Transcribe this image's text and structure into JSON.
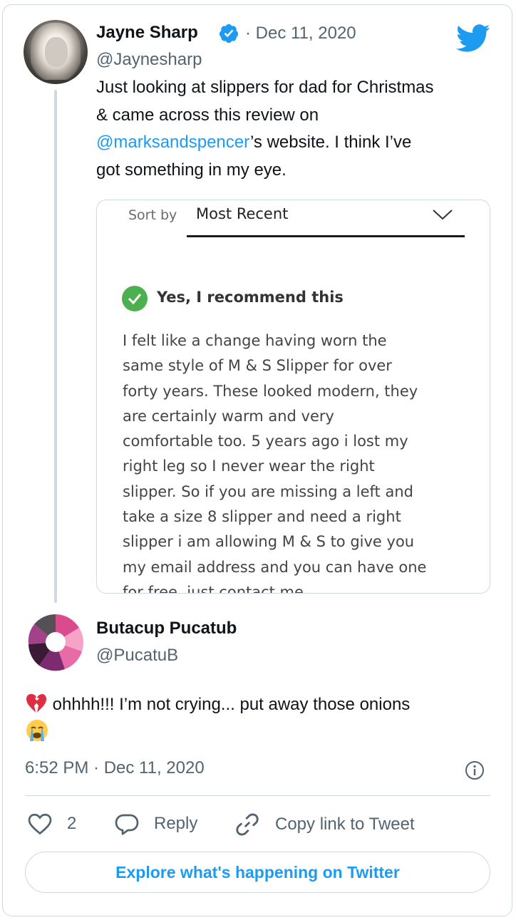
{
  "tweet": {
    "author_name": "Jayne Sharp",
    "author_handle": "@Jaynesharp",
    "date": "· Dec 11, 2020",
    "text_line1": "Just looking at slippers for dad for Christmas",
    "text_line2": "& came across this review on",
    "text_mention": "@marksandspencer",
    "text_line3_rest": "’s website. I think I’ve",
    "text_line4": "got something in my eye.",
    "verified_icon": "verified-badge-icon",
    "logo_icon": "twitter-bird-icon"
  },
  "media": {
    "sort_label": "Sort by",
    "sort_value": "Most Recent",
    "recommend": "Yes, I recommend this",
    "review_lines": [
      "I felt like a change having worn the",
      "same style of M & S Slipper for over",
      "forty years. These looked modern, they",
      "are certainly warm and very",
      "comfortable too. 5 years ago i lost my",
      "right leg so I never wear the right",
      "slipper. So if you are missing a left and",
      "take a size 8 slipper and need a right",
      "slipper i am allowing M & S to give you",
      "my email address and you can have one",
      "for free, just contact me."
    ]
  },
  "reply": {
    "author_name": "Butacup Pucatub",
    "author_handle": "@PucatuB",
    "text": "ohhhh!!! I’m not crying... put away those onions",
    "emoji_start": "broken-heart-emoji",
    "emoji_end": "crying-face-emoji",
    "timestamp": "6:52 PM · Dec 11, 2020"
  },
  "actions": {
    "like_count": "2",
    "reply_label": "Reply",
    "copy_label": "Copy link to Tweet"
  },
  "explore_label": "Explore what's happening on Twitter",
  "colors": {
    "accent": "#1d9bf0",
    "text": "#0f1419",
    "secondary": "#536471",
    "border": "#cfd9de",
    "check_green": "#4caf50"
  }
}
